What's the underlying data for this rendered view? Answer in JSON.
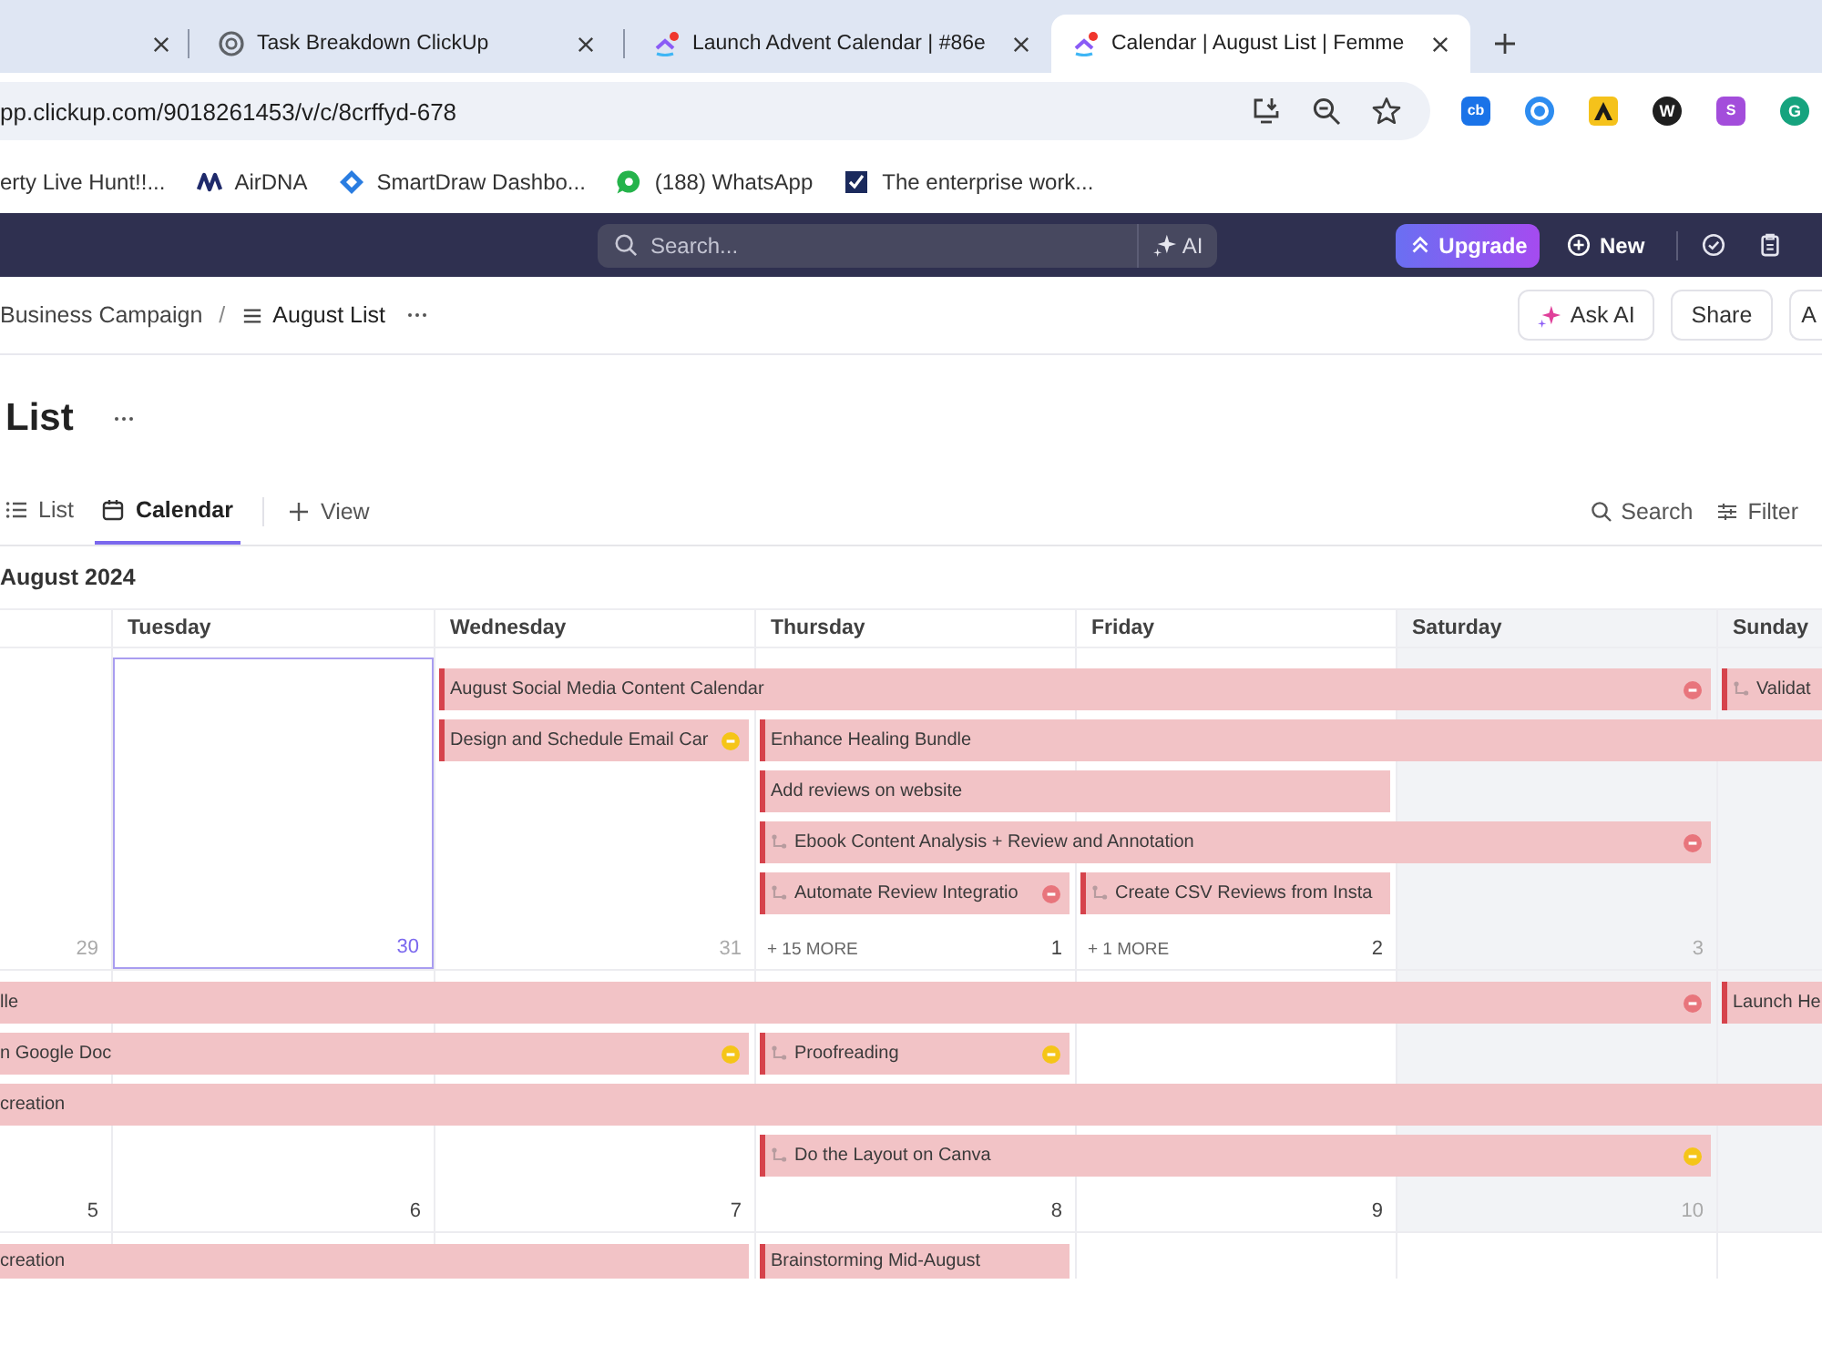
{
  "browser": {
    "tabs": [
      {
        "kind": "cut",
        "selected": false
      },
      {
        "kind": "knot",
        "title": "Task Breakdown ClickUp",
        "selected": false
      },
      {
        "kind": "chevron",
        "title": "Launch Advent Calendar | #86e",
        "selected": false
      },
      {
        "kind": "chevron",
        "title": "Calendar | August List | Femme",
        "selected": true
      }
    ],
    "url": "pp.clickup.com/9018261453/v/c/8crffyd-678",
    "extensions": [
      {
        "kind": "tile",
        "label": "cb",
        "color": "#1a73e8"
      },
      {
        "kind": "ring",
        "color": "#2d8cf0"
      },
      {
        "kind": "peak",
        "color": "#f5c21b"
      },
      {
        "kind": "disc",
        "label": "W",
        "color": "#1f1f1f"
      },
      {
        "kind": "tile",
        "label": "S",
        "color": "#a34ddb"
      },
      {
        "kind": "disc",
        "label": "G",
        "color": "#16a37e"
      }
    ],
    "bookmarks": [
      {
        "kind": "none",
        "label": "erty Live Hunt!!..."
      },
      {
        "kind": "zigzag",
        "label": "AirDNA"
      },
      {
        "kind": "diamond",
        "label": "SmartDraw Dashbo..."
      },
      {
        "kind": "bubble",
        "label": "(188) WhatsApp"
      },
      {
        "kind": "check",
        "label": "The enterprise work..."
      }
    ]
  },
  "topbar": {
    "search": {
      "placeholder": "Search..."
    },
    "ai": "AI",
    "upgrade": "Upgrade",
    "new": "New"
  },
  "breadcrumb": {
    "items": [
      {
        "kind": "plain",
        "label": "Business Campaign"
      },
      {
        "kind": "list",
        "label": "August List"
      }
    ],
    "separator": "/",
    "actions": [
      {
        "kind": "ai",
        "label": "Ask AI"
      },
      {
        "kind": "plain",
        "label": "Share"
      },
      {
        "kind": "cut",
        "label": "A"
      }
    ]
  },
  "title": "List",
  "views": {
    "tabs": [
      {
        "kind": "list",
        "label": "List",
        "selected": false
      },
      {
        "kind": "calendar",
        "label": "Calendar",
        "selected": true
      }
    ],
    "add": "View",
    "tools": [
      {
        "kind": "search",
        "label": "Search"
      },
      {
        "kind": "filter",
        "label": "Filter"
      }
    ]
  },
  "calendar": {
    "month": "August 2024",
    "columns": [
      {
        "weekend": false
      },
      {
        "name": "Tuesday",
        "weekend": false
      },
      {
        "name": "Wednesday",
        "weekend": false
      },
      {
        "name": "Thursday",
        "weekend": false
      },
      {
        "name": "Friday",
        "weekend": false
      },
      {
        "name": "Saturday",
        "weekend": true
      },
      {
        "name": "Sunday",
        "weekend": true
      }
    ],
    "weeks": [
      {
        "days": [
          {
            "date": "29",
            "muted": true,
            "today": false
          },
          {
            "date": "30",
            "muted": false,
            "today": true
          },
          {
            "date": "31",
            "muted": true,
            "today": false
          },
          {
            "date": "1",
            "muted": false,
            "today": false,
            "more": "+ 15 MORE"
          },
          {
            "date": "2",
            "muted": false,
            "today": false,
            "more": "+ 1 MORE"
          },
          {
            "date": "3",
            "muted": true,
            "today": false
          },
          {
            "today": false
          }
        ],
        "lanes": [
          [
            {
              "kind": "empty"
            },
            {
              "kind": "empty"
            },
            {
              "kind": "event",
              "title": "August Social Media Content Calendar",
              "continued": false,
              "subtask": false,
              "status": {
                "color": "#e8757c"
              }
            },
            {
              "kind": "span"
            },
            {
              "kind": "span"
            },
            {
              "kind": "span"
            },
            {
              "kind": "event",
              "title": "Validat",
              "continued": false,
              "subtask": true
            }
          ],
          [
            {
              "kind": "empty"
            },
            {
              "kind": "empty"
            },
            {
              "kind": "event",
              "title": "Design and Schedule Email Car",
              "continued": false,
              "subtask": false,
              "status": {
                "color": "#f5c518"
              }
            },
            {
              "kind": "event",
              "title": "Enhance Healing Bundle",
              "continued": false,
              "subtask": false
            },
            {
              "kind": "span"
            },
            {
              "kind": "span"
            },
            {
              "kind": "span"
            }
          ],
          [
            {
              "kind": "empty"
            },
            {
              "kind": "empty"
            },
            {
              "kind": "empty"
            },
            {
              "kind": "event",
              "title": "Add reviews on website",
              "continued": false,
              "subtask": false
            },
            {
              "kind": "span"
            },
            {
              "kind": "empty"
            },
            {
              "kind": "empty"
            }
          ],
          [
            {
              "kind": "empty"
            },
            {
              "kind": "empty"
            },
            {
              "kind": "empty"
            },
            {
              "kind": "event",
              "title": "Ebook Content Analysis + Review and Annotation",
              "continued": false,
              "subtask": true,
              "status": {
                "color": "#e8757c"
              }
            },
            {
              "kind": "span"
            },
            {
              "kind": "span"
            },
            {
              "kind": "empty"
            }
          ],
          [
            {
              "kind": "empty"
            },
            {
              "kind": "empty"
            },
            {
              "kind": "empty"
            },
            {
              "kind": "event",
              "title": "Automate Review Integratio",
              "continued": false,
              "subtask": true,
              "status": {
                "color": "#e8757c"
              }
            },
            {
              "kind": "event",
              "title": "Create CSV Reviews from Insta",
              "continued": false,
              "subtask": true
            },
            {
              "kind": "empty"
            },
            {
              "kind": "empty"
            }
          ]
        ]
      },
      {
        "days": [
          {
            "date": "5",
            "muted": false,
            "today": false
          },
          {
            "date": "6",
            "muted": false,
            "today": false
          },
          {
            "date": "7",
            "muted": false,
            "today": false
          },
          {
            "date": "8",
            "muted": false,
            "today": false
          },
          {
            "date": "9",
            "muted": false,
            "today": false
          },
          {
            "date": "10",
            "muted": true,
            "today": false
          },
          {
            "today": false
          }
        ],
        "lanes": [
          [
            {
              "kind": "event",
              "title": "lle",
              "continued": true,
              "subtask": false,
              "status": {
                "color": "#e8757c"
              }
            },
            {
              "kind": "span"
            },
            {
              "kind": "span"
            },
            {
              "kind": "span"
            },
            {
              "kind": "span"
            },
            {
              "kind": "span"
            },
            {
              "kind": "event",
              "title": "Launch He",
              "continued": false,
              "subtask": false
            }
          ],
          [
            {
              "kind": "event",
              "title": "n Google Doc",
              "continued": true,
              "subtask": false,
              "status": {
                "color": "#f5c518"
              }
            },
            {
              "kind": "span"
            },
            {
              "kind": "span"
            },
            {
              "kind": "event",
              "title": "Proofreading",
              "continued": false,
              "subtask": true,
              "status": {
                "color": "#f5c518"
              }
            },
            {
              "kind": "empty"
            },
            {
              "kind": "empty"
            },
            {
              "kind": "empty"
            }
          ],
          [
            {
              "kind": "event",
              "title": "creation",
              "continued": true,
              "subtask": false
            },
            {
              "kind": "span"
            },
            {
              "kind": "span"
            },
            {
              "kind": "span"
            },
            {
              "kind": "span"
            },
            {
              "kind": "span"
            },
            {
              "kind": "span"
            }
          ],
          [
            {
              "kind": "empty"
            },
            {
              "kind": "empty"
            },
            {
              "kind": "empty"
            },
            {
              "kind": "event",
              "title": "Do the Layout on Canva",
              "continued": false,
              "subtask": true,
              "status": {
                "color": "#f5c518"
              }
            },
            {
              "kind": "span"
            },
            {
              "kind": "span"
            },
            {
              "kind": "empty"
            }
          ]
        ]
      },
      {
        "lanes": [
          [
            {
              "kind": "event",
              "title": "creation",
              "continued": true,
              "subtask": false
            },
            {
              "kind": "span"
            },
            {
              "kind": "span"
            },
            {
              "kind": "event",
              "title": "Brainstorming Mid-August",
              "continued": false,
              "subtask": false
            },
            {
              "kind": "empty"
            },
            {
              "kind": "empty"
            },
            {
              "kind": "empty"
            }
          ]
        ]
      }
    ]
  }
}
